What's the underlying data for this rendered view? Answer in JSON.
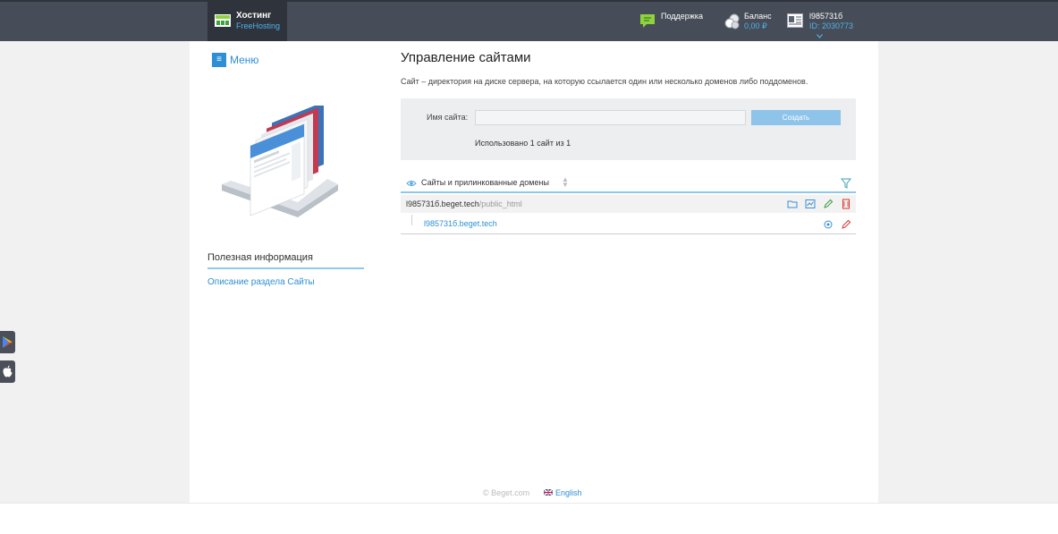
{
  "header": {
    "brand": {
      "title": "Хостинг",
      "subtitle": "FreeHosting",
      "icon": "hosting-icon"
    },
    "support": {
      "label": "Поддержка",
      "icon": "support-icon"
    },
    "balance": {
      "label": "Баланс",
      "value": "0,00 ₽",
      "icon": "coins-icon"
    },
    "account": {
      "login": "l985731б",
      "id": "ID: 2030773",
      "icon": "id-card-icon",
      "dropdown_icon": "chevron-down-icon"
    }
  },
  "sidebar": {
    "menu_label": "Меню",
    "menu_icon": "menu-icon",
    "illustration": "sites-stack-illustration",
    "info_title": "Полезная информация",
    "info_link": "Описание раздела Сайты"
  },
  "main": {
    "title": "Управление сайтами",
    "description": "Сайт – директория на диске сервера, на которую ссылается один или несколько доменов либо поддоменов.",
    "form": {
      "label": "Имя сайта:",
      "input_value": "",
      "create_label": "Создать",
      "usage": "Использовано 1 сайт из 1"
    },
    "sites_header": "Сайты и прилинкованные домены",
    "sites": [
      {
        "host": "l985731б.beget.tech",
        "dir": "/public_html",
        "icons": [
          "folder-icon",
          "stats-icon",
          "edit-icon",
          "delete-icon"
        ],
        "domains": [
          {
            "name": "l985731б.beget.tech",
            "icons": [
              "settings-icon",
              "edit-icon"
            ]
          }
        ]
      }
    ]
  },
  "footer": {
    "copyright": "© Beget.com",
    "language": "English"
  },
  "side_apps": [
    "google-play-icon",
    "apple-icon"
  ],
  "colors": {
    "accent": "#2d8fd5",
    "topbar": "#464c58",
    "button": "#8ec4ea"
  }
}
